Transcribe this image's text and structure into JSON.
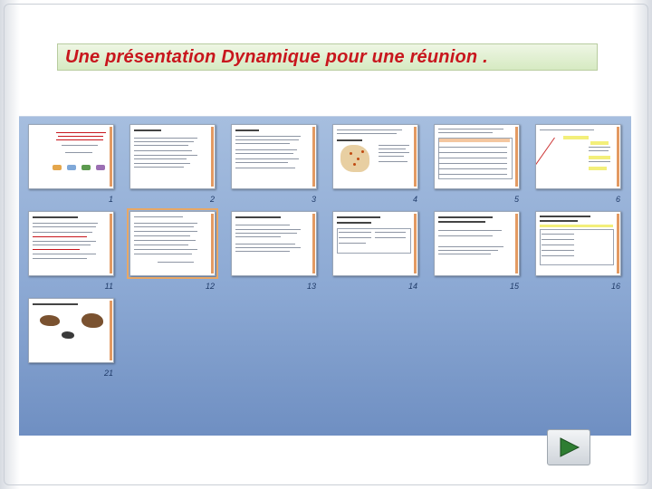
{
  "slide": {
    "title": "Une présentation Dynamique pour une réunion ."
  },
  "sorter": {
    "thumbnails": [
      {
        "number": "1"
      },
      {
        "number": "2"
      },
      {
        "number": "3"
      },
      {
        "number": "4"
      },
      {
        "number": "5"
      },
      {
        "number": "6"
      },
      {
        "number": "11"
      },
      {
        "number": "12",
        "selected": true
      },
      {
        "number": "13"
      },
      {
        "number": "14"
      },
      {
        "number": "15"
      },
      {
        "number": "16"
      },
      {
        "number": "21"
      }
    ]
  },
  "controls": {
    "next_icon": "play-triangle-icon",
    "next_color": "#2e7d32"
  }
}
